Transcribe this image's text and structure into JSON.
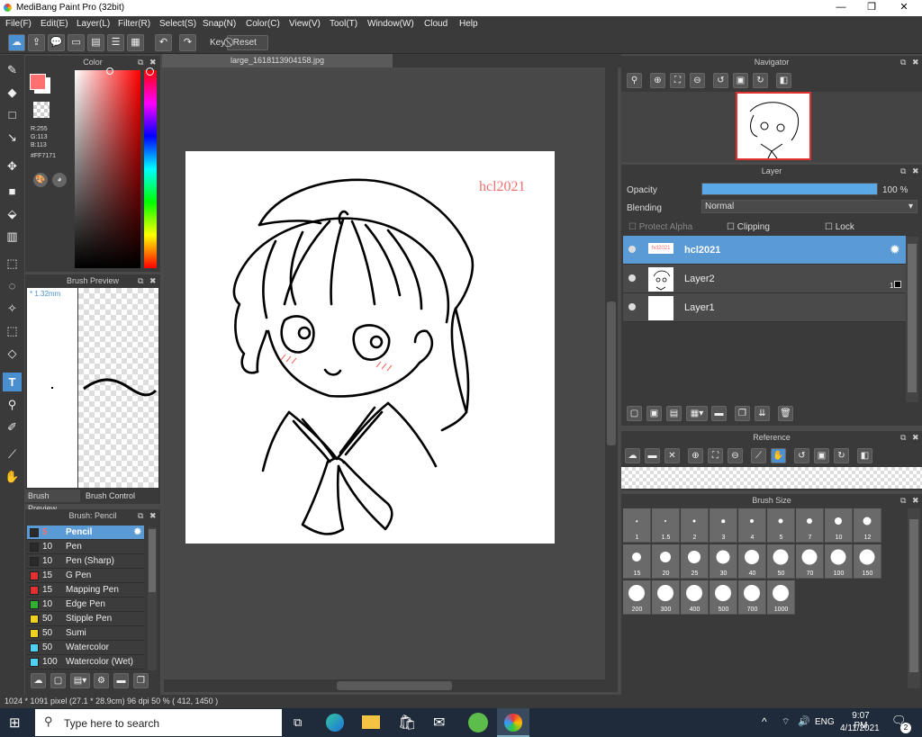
{
  "window": {
    "title": "MediBang Paint Pro (32bit)",
    "minimize": "—",
    "maximize": "❐",
    "close": "✕"
  },
  "menu": [
    "File(F)",
    "Edit(E)",
    "Layer(L)",
    "Filter(R)",
    "Select(S)",
    "Snap(N)",
    "Color(C)",
    "View(V)",
    "Tool(T)",
    "Window(W)",
    "Cloud",
    "Help"
  ],
  "toolbar": {
    "key_label": "Key",
    "reset_label": "Reset"
  },
  "color_panel": {
    "title": "Color",
    "r": "R:255",
    "g": "G:113",
    "b": "B:113",
    "hex": "#FF7171",
    "fg_color": "#FF7171"
  },
  "brush_preview": {
    "title": "Brush Preview",
    "size": "* 1.32mm",
    "tab1": "Brush Preview",
    "tab2": "Brush Control"
  },
  "brush_panel": {
    "title": "Brush: Pencil",
    "items": [
      {
        "size": "5",
        "name": "Pencil",
        "color": "#2a2a2a",
        "selected": true
      },
      {
        "size": "10",
        "name": "Pen",
        "color": "#2a2a2a"
      },
      {
        "size": "10",
        "name": "Pen (Sharp)",
        "color": "#2a2a2a"
      },
      {
        "size": "15",
        "name": "G Pen",
        "color": "#e03030"
      },
      {
        "size": "15",
        "name": "Mapping Pen",
        "color": "#e03030"
      },
      {
        "size": "10",
        "name": "Edge Pen",
        "color": "#30b030"
      },
      {
        "size": "50",
        "name": "Stipple Pen",
        "color": "#f0d020"
      },
      {
        "size": "50",
        "name": "Sumi",
        "color": "#f0d020"
      },
      {
        "size": "50",
        "name": "Watercolor",
        "color": "#50d0f0"
      },
      {
        "size": "100",
        "name": "Watercolor (Wet)",
        "color": "#50d0f0"
      }
    ]
  },
  "canvas": {
    "tab": "large_1618113904158.jpg",
    "signature": "hcl2021"
  },
  "navigator": {
    "title": "Navigator"
  },
  "layer_panel": {
    "title": "Layer",
    "opacity_label": "Opacity",
    "opacity_value": "100 %",
    "opacity": 1.0,
    "blending_label": "Blending",
    "blending_value": "Normal",
    "protect_alpha": "Protect Alpha",
    "clipping": "Clipping",
    "lock": "Lock",
    "layers": [
      {
        "name": "hcl2021",
        "selected": true
      },
      {
        "name": "Layer2",
        "badge": "1"
      },
      {
        "name": "Layer1"
      }
    ]
  },
  "reference": {
    "title": "Reference"
  },
  "brush_size": {
    "title": "Brush Size",
    "sizes": [
      "1",
      "1.5",
      "2",
      "3",
      "4",
      "5",
      "7",
      "10",
      "12",
      "15",
      "20",
      "25",
      "30",
      "40",
      "50",
      "70",
      "100",
      "150",
      "200",
      "300",
      "400",
      "500",
      "700",
      "1000"
    ]
  },
  "status": {
    "text": "1024 * 1091 pixel  (27.1 * 28.9cm)  96 dpi  50 %  ( 412, 1450 )"
  },
  "taskbar": {
    "search_placeholder": "Type here to search",
    "lang": "ENG",
    "time": "9:07 PM",
    "date": "4/11/2021",
    "notif": "2"
  }
}
